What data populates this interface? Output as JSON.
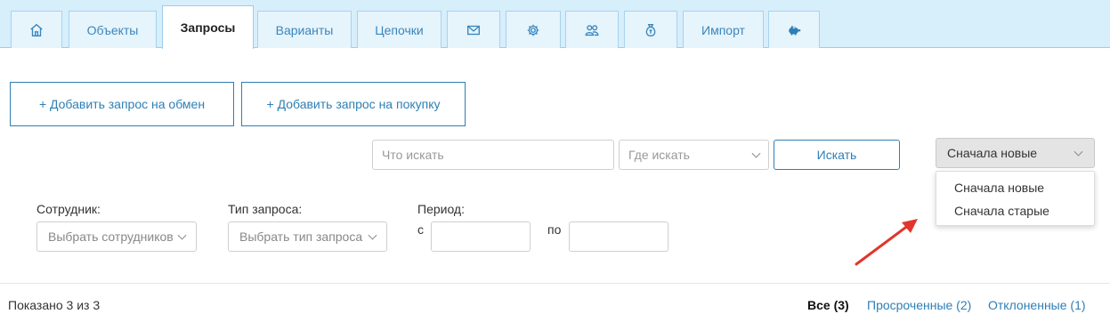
{
  "tabs": [
    {
      "type": "icon",
      "icon": "home-icon"
    },
    {
      "type": "text",
      "label": "Объекты"
    },
    {
      "type": "text",
      "label": "Запросы",
      "active": true
    },
    {
      "type": "text",
      "label": "Варианты"
    },
    {
      "type": "text",
      "label": "Цепочки"
    },
    {
      "type": "icon",
      "icon": "mail-icon"
    },
    {
      "type": "icon",
      "icon": "gear-icon"
    },
    {
      "type": "icon",
      "icon": "users-icon"
    },
    {
      "type": "icon",
      "icon": "money-bag-icon"
    },
    {
      "type": "text",
      "label": "Импорт"
    },
    {
      "type": "icon",
      "icon": "piggy-bank-icon"
    }
  ],
  "actions": {
    "add_exchange": "+ Добавить запрос на обмен",
    "add_purchase": "+ Добавить запрос на покупку"
  },
  "search": {
    "what_placeholder": "Что искать",
    "where_placeholder": "Где искать",
    "button": "Искать"
  },
  "sort": {
    "selected": "Сначала новые",
    "options": [
      "Сначала новые",
      "Сначала старые"
    ]
  },
  "filters": {
    "employee_label": "Сотрудник:",
    "employee_placeholder": "Выбрать сотрудников",
    "type_label": "Тип запроса:",
    "type_placeholder": "Выбрать тип запроса",
    "period_label": "Период:",
    "from_label": "с",
    "to_label": "по"
  },
  "footer": {
    "shown": "Показано 3 из 3",
    "all": "Все (3)",
    "overdue": "Просроченные (2)",
    "rejected": "Отклоненные (1)"
  },
  "colors": {
    "accent": "#2e7fb5",
    "tabbar": "#d7eefb",
    "annotation_arrow": "#e0362c"
  }
}
